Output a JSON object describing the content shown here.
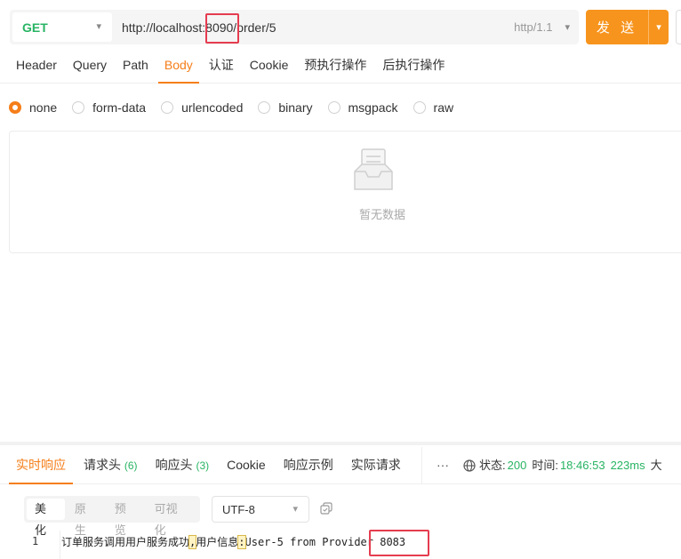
{
  "request": {
    "method": "GET",
    "url": "http://localhost:8090/order/5",
    "http_version": "http/1.1",
    "send_label": "发 送"
  },
  "tabs": [
    "Header",
    "Query",
    "Path",
    "Body",
    "认证",
    "Cookie",
    "预执行操作",
    "后执行操作"
  ],
  "active_tab": "Body",
  "body_types": [
    "none",
    "form-data",
    "urlencoded",
    "binary",
    "msgpack",
    "raw"
  ],
  "selected_body_type": "none",
  "empty_text": "暂无数据",
  "response": {
    "tabs": [
      {
        "label": "实时响应",
        "count": ""
      },
      {
        "label": "请求头",
        "count": "(6)"
      },
      {
        "label": "响应头",
        "count": "(3)"
      },
      {
        "label": "Cookie",
        "count": ""
      },
      {
        "label": "响应示例",
        "count": ""
      },
      {
        "label": "实际请求",
        "count": ""
      }
    ],
    "more": "···",
    "status_label": "状态:",
    "status_code": "200",
    "time_label": "时间:",
    "time_value": "18:46:53",
    "duration": "223ms",
    "size_label": "大",
    "view_modes": [
      "美化",
      "原生",
      "预览",
      "可视化"
    ],
    "active_view_mode": "美化",
    "encoding": "UTF-8",
    "line_number": "1",
    "content_part1": "订单服务调用用户服务成功",
    "content_sep1": ",",
    "content_part2": "用户信息",
    "content_sep2": ":",
    "content_part3": "User-5 from Provider 8083"
  },
  "colors": {
    "accent": "#f57e19",
    "send_button": "#f7941d",
    "method": "#28b463",
    "annotation": "#e53c4f"
  }
}
